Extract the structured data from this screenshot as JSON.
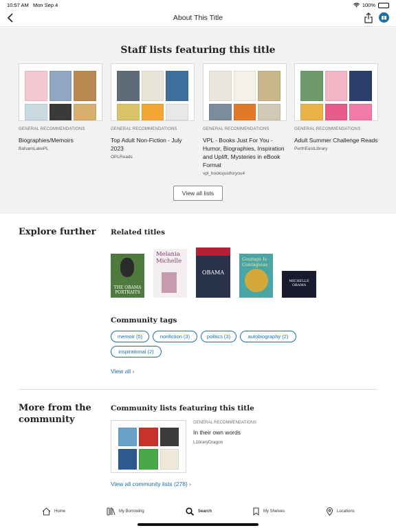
{
  "status_bar": {
    "time": "10:57 AM",
    "date": "Mon Sep 4",
    "battery": "100%",
    "battery_level": 1.0
  },
  "nav": {
    "title": "About This Title",
    "back_icon": "chevron-left-icon",
    "share_icon": "share-icon",
    "account_icon": "library-badge-icon"
  },
  "staff_lists": {
    "heading": "Staff lists featuring this title",
    "lists": [
      {
        "category": "GENERAL RECOMMENDATIONS",
        "title": "Biographies/Memoirs",
        "user": "BalsamLakePL",
        "cover_colors": [
          "#f2c7cf",
          "#8fa7c2",
          "#b88a50",
          "#c8d9e0",
          "#3a3a3a",
          "#d9b070"
        ]
      },
      {
        "category": "GENERAL RECOMMENDATIONS",
        "title": "Top Adult Non-Fiction - July 2023",
        "user": "OPLReads",
        "cover_colors": [
          "#5e6c7a",
          "#e8e4d8",
          "#3d6e9e",
          "#d9c46a",
          "#f2a634",
          "#e8e8e8"
        ]
      },
      {
        "category": "GENERAL RECOMMENDATIONS",
        "title": "VPL - Books Just For You - Humor, Biographies, Inspiration and Uplift, Mysteries in eBook Format",
        "user": "vpl_booksjustforyou4",
        "cover_colors": [
          "#e9e6dc",
          "#f4f1e8",
          "#c9b68a",
          "#7b8c9a",
          "#e07a2a",
          "#d2c9b6"
        ]
      },
      {
        "category": "GENERAL RECOMMENDATIONS",
        "title": "Adult Summer Challenge Reads",
        "user": "PerthEastLibrary",
        "cover_colors": [
          "#6f9a6e",
          "#f3b5c4",
          "#2a3f6b",
          "#e9b347",
          "#e85a8a",
          "#f07aa8"
        ]
      }
    ],
    "view_all": "View all lists"
  },
  "explore": {
    "heading": "Explore further",
    "related_heading": "Related titles",
    "related_titles": [
      {
        "cover_text": "THE OBAMA PORTRAITS",
        "bg": "#4f7a3e"
      },
      {
        "cover_text": "Melania Michelle",
        "bg": "#f3eef0"
      },
      {
        "cover_text": "OBAMA",
        "bg": "#28324a"
      },
      {
        "cover_text": "Courage Is Contagious",
        "bg": "#4aa6a6"
      },
      {
        "cover_text": "MICHELLE OBAMA",
        "bg": "#1a1a2e"
      }
    ],
    "tags_heading": "Community tags",
    "tags": [
      "memoir (5)",
      "nonfiction (3)",
      "politics (3)",
      "autobiography (2)",
      "inspirational (2)"
    ],
    "view_all": "View all ›"
  },
  "community": {
    "heading": "More from the community",
    "lists_heading": "Community lists featuring this title",
    "list": {
      "category": "GENERAL RECOMMENDATIONS",
      "title": "In their own words",
      "user": "L1braryDragon",
      "cover_colors": [
        "#6aa3c8",
        "#c7322b",
        "#3c3c3c",
        "#2c5a8c",
        "#4aa84a",
        "#efe9dc"
      ]
    },
    "view_all": "View all community lists (278) ›"
  },
  "tab_bar": {
    "items": [
      {
        "label": "Home",
        "icon": "home-icon"
      },
      {
        "label": "My Borrowing",
        "icon": "books-icon"
      },
      {
        "label": "Search",
        "icon": "search-icon"
      },
      {
        "label": "My Shelves",
        "icon": "bookmark-icon"
      },
      {
        "label": "Locations",
        "icon": "location-pin-icon"
      }
    ]
  }
}
